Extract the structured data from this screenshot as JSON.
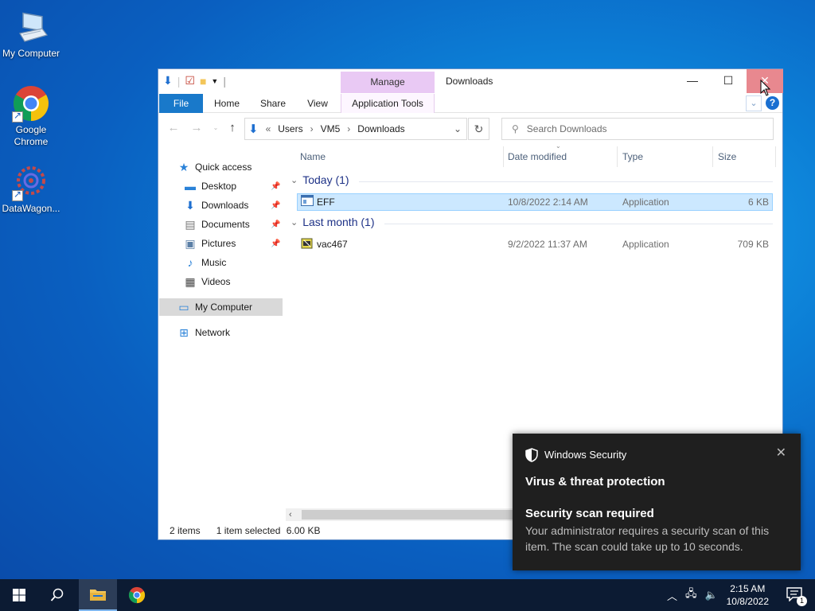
{
  "desktop": {
    "icons": [
      {
        "label": "My Computer",
        "icon": "computer-icon"
      },
      {
        "label": "Google Chrome",
        "icon": "chrome-icon"
      },
      {
        "label": "DataWagon...",
        "icon": "datawagon-icon"
      }
    ]
  },
  "window": {
    "title": "Downloads",
    "contextual_tab": "Manage",
    "ribbon_tabs": [
      "File",
      "Home",
      "Share",
      "View",
      "Application Tools"
    ],
    "address": {
      "prefix": "«",
      "crumbs": [
        "Users",
        "VM5",
        "Downloads"
      ]
    },
    "search_placeholder": "Search Downloads",
    "nav_pane": {
      "quick_access": "Quick access",
      "items": [
        "Desktop",
        "Downloads",
        "Documents",
        "Pictures",
        "Music",
        "Videos"
      ],
      "my_computer": "My Computer",
      "network": "Network"
    },
    "columns": [
      "Name",
      "Date modified",
      "Type",
      "Size"
    ],
    "groups": [
      {
        "label": "Today (1)",
        "files": [
          {
            "name": "EFF",
            "date": "10/8/2022 2:14 AM",
            "type": "Application",
            "size": "6 KB",
            "selected": true
          }
        ]
      },
      {
        "label": "Last month (1)",
        "files": [
          {
            "name": "vac467",
            "date": "9/2/2022 11:37 AM",
            "type": "Application",
            "size": "709 KB",
            "selected": false
          }
        ]
      }
    ],
    "status": {
      "items": "2 items",
      "selected": "1 item selected",
      "size": "6.00 KB"
    }
  },
  "toast": {
    "app": "Windows Security",
    "heading": "Virus & threat protection",
    "title": "Security scan required",
    "body": "Your administrator requires a security scan of this item. The scan could take up to 10 seconds."
  },
  "taskbar": {
    "time": "2:15 AM",
    "date": "10/8/2022",
    "notification_count": "1"
  },
  "colors": {
    "accent": "#1979ca",
    "manage_tab": "#e9c9f4",
    "close_hover": "#e8888f",
    "selection": "#cce8ff"
  }
}
